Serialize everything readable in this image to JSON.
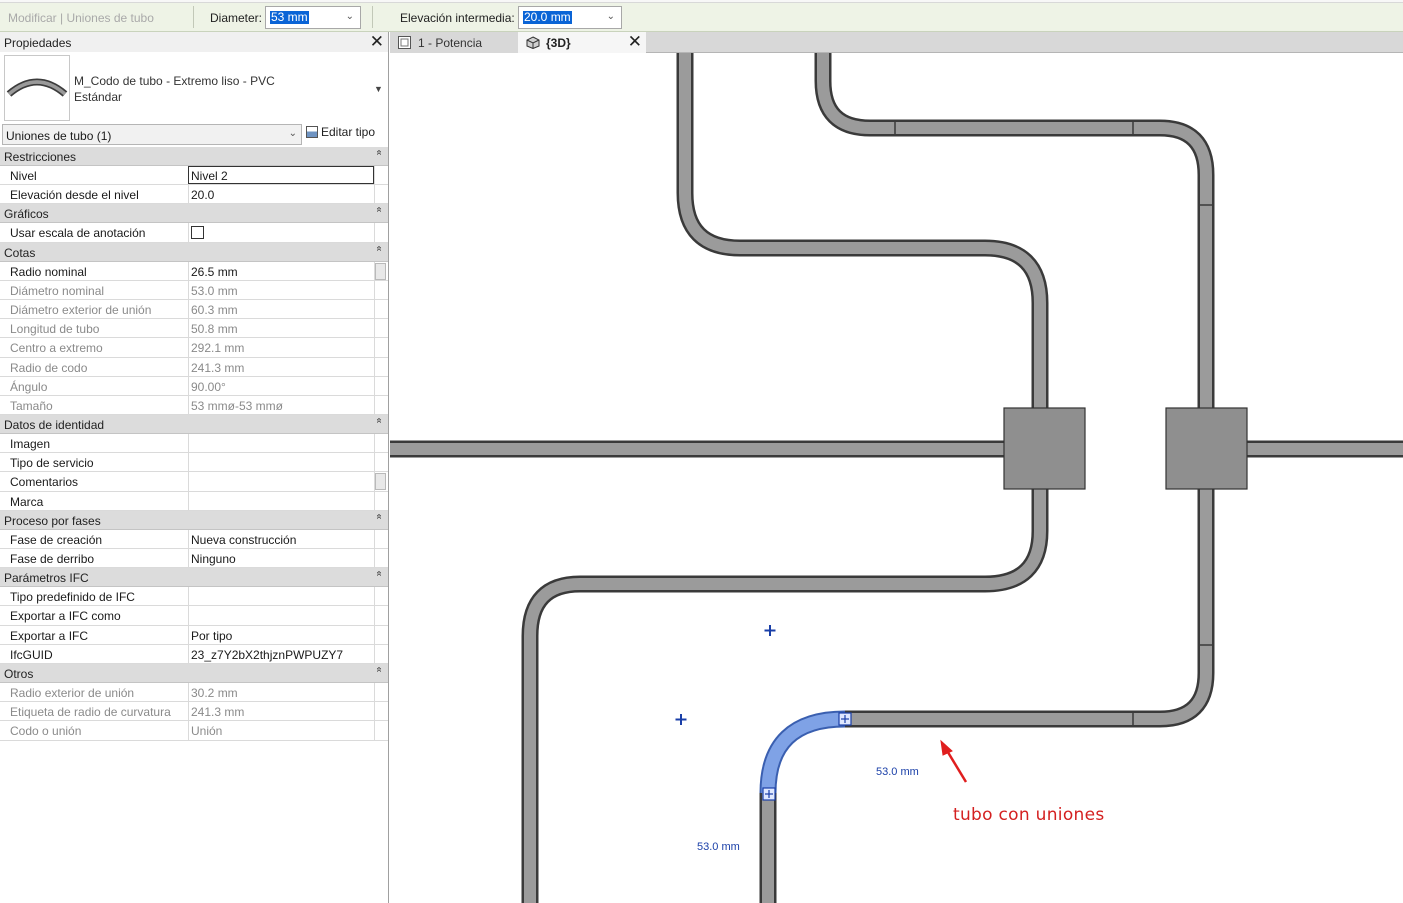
{
  "options_bar": {
    "context_label": "Modificar | Uniones de tubo",
    "diameter_label": "Diameter:",
    "diameter_value": "53 mm",
    "elevation_label": "Elevación intermedia:",
    "elevation_value": "20.0 mm"
  },
  "properties": {
    "title": "Propiedades",
    "type_name": "M_Codo de tubo - Extremo liso - PVC",
    "type_sub": "Estándar",
    "selector_value": "Uniones de tubo (1)",
    "edit_type_label": "Editar tipo",
    "groups": [
      {
        "label": "Restricciones",
        "rows": [
          {
            "key": "Nivel",
            "value": "Nivel 2",
            "readonly": false,
            "editing": true
          },
          {
            "key": "Elevación desde el nivel",
            "value": "20.0",
            "readonly": false
          }
        ]
      },
      {
        "label": "Gráficos",
        "rows": [
          {
            "key": "Usar escala de anotación",
            "value": "",
            "readonly": false,
            "checkbox": true,
            "checked": false
          }
        ]
      },
      {
        "label": "Cotas",
        "rows": [
          {
            "key": "Radio nominal",
            "value": "26.5 mm",
            "readonly": false,
            "thumb": true
          },
          {
            "key": "Diámetro nominal",
            "value": "53.0 mm",
            "readonly": true
          },
          {
            "key": "Diámetro exterior de unión",
            "value": "60.3 mm",
            "readonly": true
          },
          {
            "key": "Longitud de tubo",
            "value": "50.8 mm",
            "readonly": true
          },
          {
            "key": "Centro a extremo",
            "value": "292.1 mm",
            "readonly": true
          },
          {
            "key": "Radio de codo",
            "value": "241.3 mm",
            "readonly": true
          },
          {
            "key": "Ángulo",
            "value": "90.00°",
            "readonly": true
          },
          {
            "key": "Tamaño",
            "value": "53 mmø-53 mmø",
            "readonly": true
          }
        ]
      },
      {
        "label": "Datos de identidad",
        "rows": [
          {
            "key": "Imagen",
            "value": "",
            "readonly": false
          },
          {
            "key": "Tipo de servicio",
            "value": "",
            "readonly": false
          },
          {
            "key": "Comentarios",
            "value": "",
            "readonly": false,
            "thumb": true
          },
          {
            "key": "Marca",
            "value": "",
            "readonly": false
          }
        ]
      },
      {
        "label": "Proceso por fases",
        "rows": [
          {
            "key": "Fase de creación",
            "value": "Nueva construcción",
            "readonly": false
          },
          {
            "key": "Fase de derribo",
            "value": "Ninguno",
            "readonly": false
          }
        ]
      },
      {
        "label": "Parámetros IFC",
        "rows": [
          {
            "key": "Tipo predefinido de IFC",
            "value": "",
            "readonly": false
          },
          {
            "key": "Exportar a IFC como",
            "value": "",
            "readonly": false
          },
          {
            "key": "Exportar a IFC",
            "value": "Por tipo",
            "readonly": false
          },
          {
            "key": "IfcGUID",
            "value": "23_z7Y2bX2thjznPWPUZY7",
            "readonly": false
          }
        ]
      },
      {
        "label": "Otros",
        "rows": [
          {
            "key": "Radio exterior de unión",
            "value": "30.2 mm",
            "readonly": true
          },
          {
            "key": "Etiqueta de radio de curvatura",
            "value": "241.3 mm",
            "readonly": true
          },
          {
            "key": "Codo o unión",
            "value": "Unión",
            "readonly": true
          }
        ]
      }
    ]
  },
  "tabs": [
    {
      "label": "1 - Potencia",
      "icon": "plan-view-icon",
      "active": false
    },
    {
      "label": "{3D}",
      "icon": "3d-view-icon",
      "active": true
    }
  ],
  "viewport": {
    "dim_horizontal": "53.0 mm",
    "dim_vertical": "53.0 mm",
    "annotation": "tubo con uniones",
    "colors": {
      "pipe": "#9b9b9b",
      "pipe_edge": "#3a3a3a",
      "selected": "#7fa2e6",
      "annotation": "#d42020",
      "dims": "#1a3fa8"
    }
  }
}
